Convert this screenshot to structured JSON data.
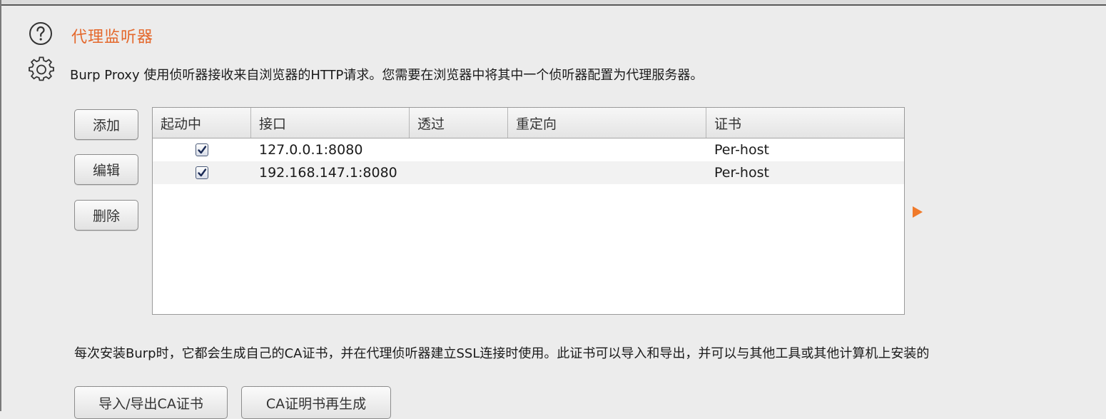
{
  "header": {
    "title": "代理监听器",
    "description": "Burp Proxy 使用侦听器接收来自浏览器的HTTP请求。您需要在浏览器中将其中一个侦听器配置为代理服务器。",
    "help_icon": "help-circle-icon",
    "settings_icon": "gear-icon"
  },
  "side_buttons": {
    "add": "添加",
    "edit": "编辑",
    "delete": "删除"
  },
  "table": {
    "columns": [
      "起动中",
      "接口",
      "透过",
      "重定向",
      "证书"
    ],
    "rows": [
      {
        "running": true,
        "interface": "127.0.0.1:8080",
        "invisible": "",
        "redirect": "",
        "certificate": "Per-host"
      },
      {
        "running": true,
        "interface": "192.168.147.1:8080",
        "invisible": "",
        "redirect": "",
        "certificate": "Per-host"
      }
    ]
  },
  "ca_section": {
    "text": "每次安装Burp时，它都会生成自己的CA证书，并在代理侦听器建立SSL连接时使用。此证书可以导入和导出，并可以与其他工具或其他计算机上安装的",
    "import_export_button": "导入/导出CA证书",
    "regenerate_button": "CA证明书再生成"
  },
  "colors": {
    "title": "#e4682c",
    "arrow": "#f07a2a",
    "background": "#ececec"
  }
}
